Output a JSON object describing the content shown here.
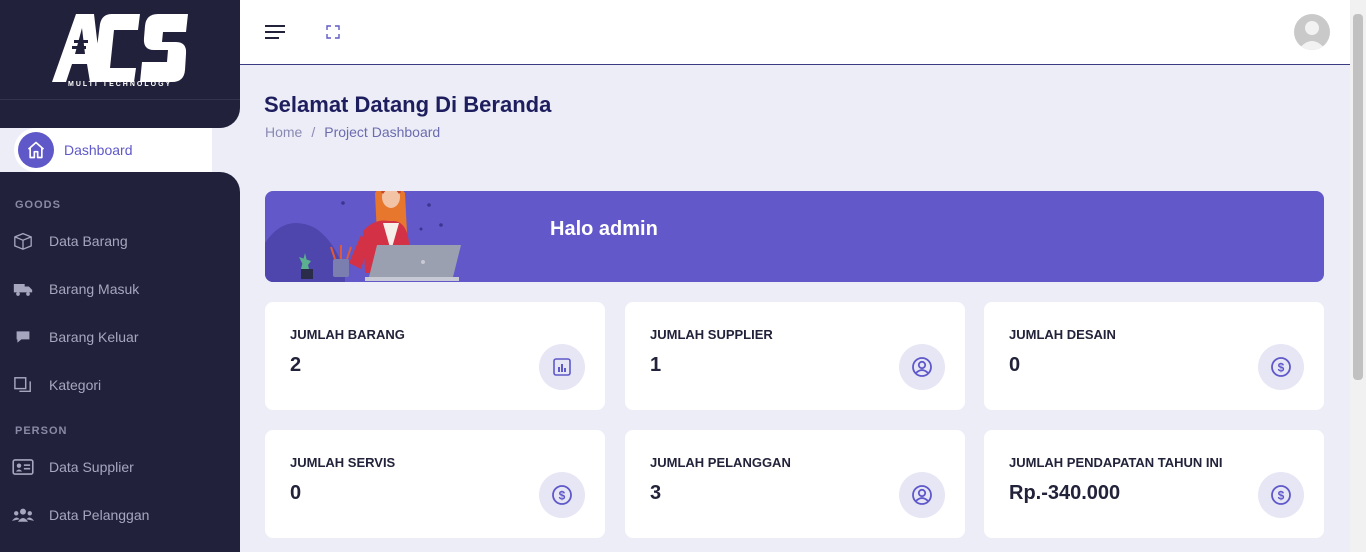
{
  "brand": {
    "logo_text": "ACS",
    "logo_subtext": "MULTI TECHNOLOGY"
  },
  "sidebar": {
    "active": {
      "label": "Dashboard",
      "icon": "home-icon"
    },
    "sections": [
      {
        "title": "GOODS",
        "items": [
          {
            "label": "Data Barang",
            "icon": "box-icon"
          },
          {
            "label": "Barang Masuk",
            "icon": "truck-icon"
          },
          {
            "label": "Barang Keluar",
            "icon": "chat-icon"
          },
          {
            "label": "Kategori",
            "icon": "copy-icon"
          }
        ]
      },
      {
        "title": "PERSON",
        "items": [
          {
            "label": "Data Supplier",
            "icon": "id-card-icon"
          },
          {
            "label": "Data Pelanggan",
            "icon": "users-icon"
          }
        ]
      }
    ]
  },
  "topbar": {
    "menu_icon": "hamburger-icon",
    "fullscreen_icon": "expand-icon",
    "avatar_icon": "user-avatar-icon"
  },
  "page": {
    "title": "Selamat Datang Di Beranda",
    "breadcrumb": {
      "home": "Home",
      "separator": "/",
      "current": "Project Dashboard"
    }
  },
  "banner": {
    "greeting": "Halo  admin"
  },
  "cards": [
    {
      "label": "JUMLAH BARANG",
      "value": "2",
      "icon": "chart-icon"
    },
    {
      "label": "JUMLAH SUPPLIER",
      "value": "1",
      "icon": "user-circle-icon"
    },
    {
      "label": "JUMLAH DESAIN",
      "value": "0",
      "icon": "dollar-icon"
    },
    {
      "label": "JUMLAH SERVIS",
      "value": "0",
      "icon": "dollar-icon"
    },
    {
      "label": "JUMLAH PELANGGAN",
      "value": "3",
      "icon": "user-circle-icon"
    },
    {
      "label": "JUMLAH PENDAPATAN TAHUN INI",
      "value": "Rp.-340.000",
      "icon": "dollar-icon"
    }
  ],
  "colors": {
    "sidebar_bg": "#22213b",
    "accent": "#6358c9",
    "page_bg": "#ecedf7",
    "text_dark": "#22223a"
  }
}
